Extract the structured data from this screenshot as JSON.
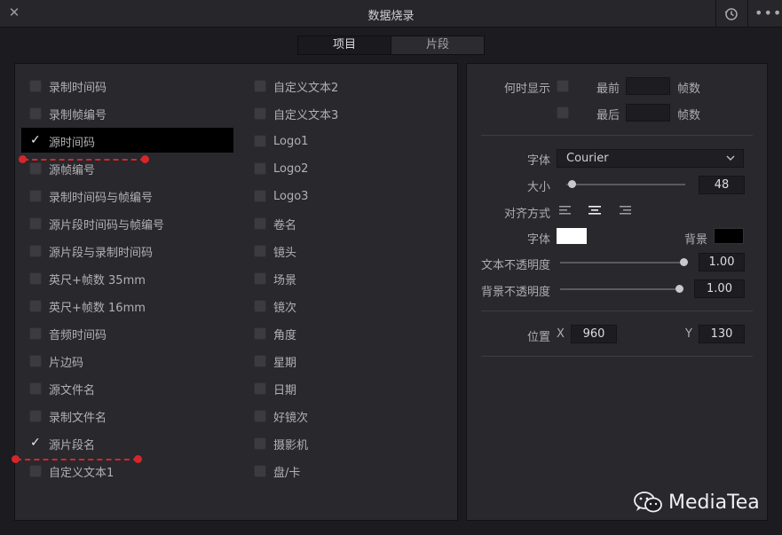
{
  "window": {
    "title": "数据烧录",
    "close_icon": "close-icon",
    "history_icon": "history-icon",
    "more_icon": "more-icon",
    "more_glyph": "•••"
  },
  "tabs": [
    {
      "label": "项目",
      "active": true
    },
    {
      "label": "片段",
      "active": false
    }
  ],
  "left": {
    "col1": [
      {
        "label": "录制时间码",
        "checked": false
      },
      {
        "label": "录制帧编号",
        "checked": false
      },
      {
        "label": "源时间码",
        "checked": true
      },
      {
        "label": "源帧编号",
        "checked": false
      },
      {
        "label": "录制时间码与帧编号",
        "checked": false
      },
      {
        "label": "源片段时间码与帧编号",
        "checked": false
      },
      {
        "label": "源片段与录制时间码",
        "checked": false
      },
      {
        "label": "英尺+帧数 35mm",
        "checked": false
      },
      {
        "label": "英尺+帧数 16mm",
        "checked": false
      },
      {
        "label": "音频时间码",
        "checked": false
      },
      {
        "label": "片边码",
        "checked": false
      },
      {
        "label": "源文件名",
        "checked": false
      },
      {
        "label": "录制文件名",
        "checked": false
      },
      {
        "label": "源片段名",
        "checked": true
      },
      {
        "label": "自定义文本1",
        "checked": false
      }
    ],
    "col2": [
      {
        "label": "自定义文本2",
        "checked": false
      },
      {
        "label": "自定义文本3",
        "checked": false
      },
      {
        "label": "Logo1",
        "checked": false
      },
      {
        "label": "Logo2",
        "checked": false
      },
      {
        "label": "Logo3",
        "checked": false
      },
      {
        "label": "卷名",
        "checked": false
      },
      {
        "label": "镜头",
        "checked": false
      },
      {
        "label": "场景",
        "checked": false
      },
      {
        "label": "镜次",
        "checked": false
      },
      {
        "label": "角度",
        "checked": false
      },
      {
        "label": "星期",
        "checked": false
      },
      {
        "label": "日期",
        "checked": false
      },
      {
        "label": "好镜次",
        "checked": false
      },
      {
        "label": "摄影机",
        "checked": false
      },
      {
        "label": "盘/卡",
        "checked": false
      }
    ]
  },
  "right": {
    "when_show": {
      "label": "何时显示",
      "first_label": "最前",
      "last_label": "最后",
      "frames_label": "帧数",
      "first_value": "",
      "last_value": ""
    },
    "font": {
      "label": "字体",
      "value": "Courier"
    },
    "size": {
      "label": "大小",
      "value": "48",
      "slider": 0.05
    },
    "align": {
      "label": "对齐方式",
      "options": [
        "align-left-icon",
        "align-center-icon",
        "align-right-icon"
      ],
      "selected": "align-center-icon"
    },
    "font_color": {
      "label": "字体",
      "color": "#ffffff"
    },
    "bg_color": {
      "label": "背景",
      "color": "#000000"
    },
    "text_opacity": {
      "label": "文本不透明度",
      "value": "1.00",
      "slider": 1.0
    },
    "bg_opacity": {
      "label": "背景不透明度",
      "value": "1.00",
      "slider": 1.0
    },
    "position": {
      "label": "位置",
      "x_label": "X",
      "x_value": "960",
      "y_label": "Y",
      "y_value": "130"
    }
  },
  "annotation_color": "#d6262a",
  "watermark": {
    "text": "MediaTea",
    "icon": "wechat-icon"
  }
}
